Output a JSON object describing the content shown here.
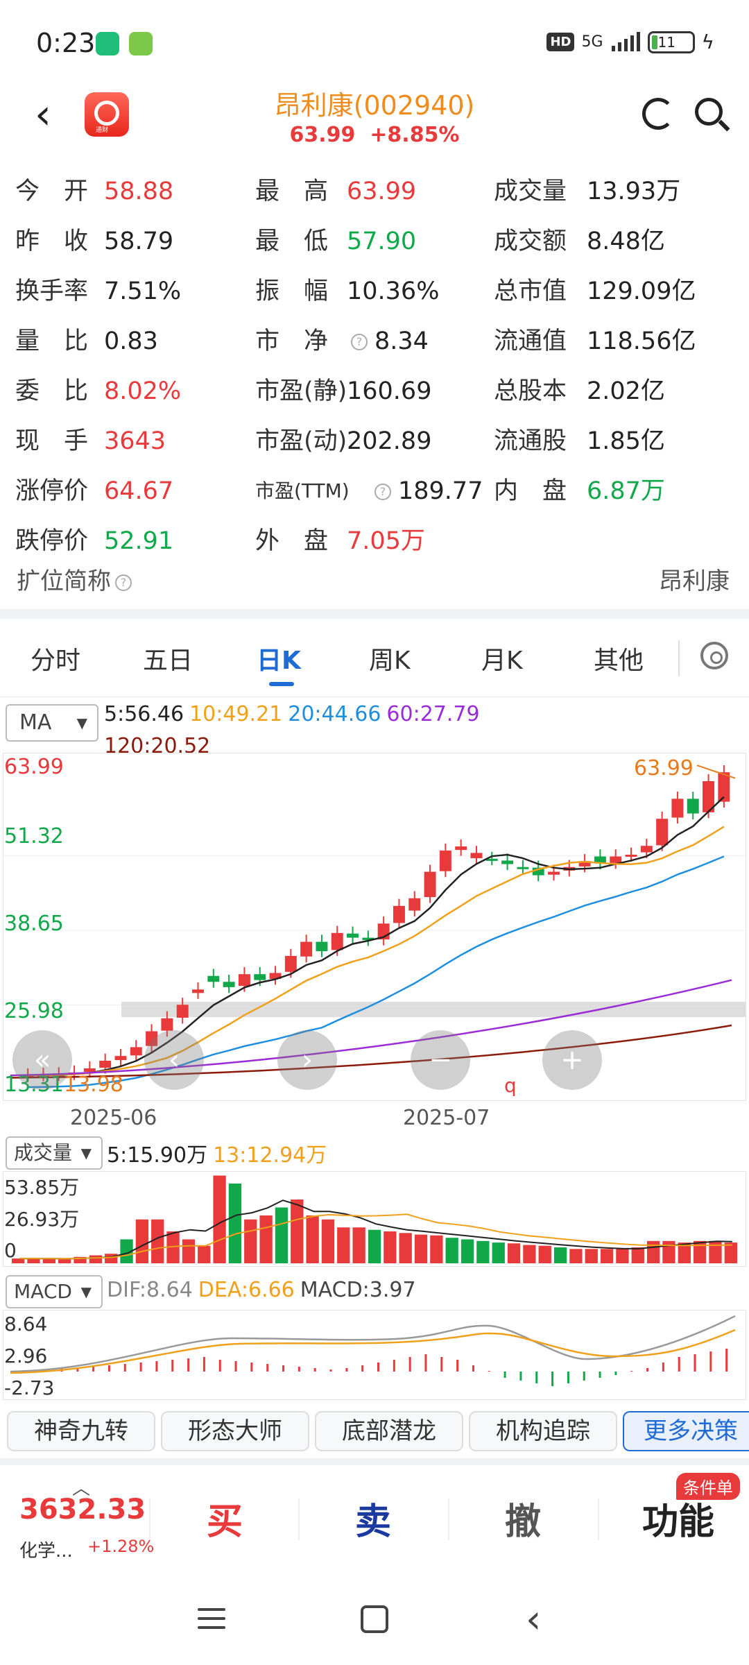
{
  "status": {
    "time": "0:23",
    "network": "5G",
    "battery": "11"
  },
  "header": {
    "title": "昂利康(002940)",
    "price": "63.99",
    "change_pct": "+8.85%",
    "logo_tag": "通财"
  },
  "quote": [
    [
      {
        "label": "今　开",
        "value": "58.88",
        "cls": "red"
      },
      {
        "label": "最　高",
        "value": "63.99",
        "cls": "red"
      },
      {
        "label": "成交量",
        "value": "13.93万",
        "cls": ""
      }
    ],
    [
      {
        "label": "昨　收",
        "value": "58.79",
        "cls": ""
      },
      {
        "label": "最　低",
        "value": "57.90",
        "cls": "green"
      },
      {
        "label": "成交额",
        "value": "8.48亿",
        "cls": ""
      }
    ],
    [
      {
        "label": "换手率",
        "value": "7.51%",
        "cls": ""
      },
      {
        "label": "振　幅",
        "value": "10.36%",
        "cls": ""
      },
      {
        "label": "总市值",
        "value": "129.09亿",
        "cls": ""
      }
    ],
    [
      {
        "label": "量　比",
        "value": "0.83",
        "cls": ""
      },
      {
        "label": "市　净",
        "value": "8.34",
        "cls": "",
        "hint": true
      },
      {
        "label": "流通值",
        "value": "118.56亿",
        "cls": ""
      }
    ],
    [
      {
        "label": "委　比",
        "value": "8.02%",
        "cls": "red"
      },
      {
        "label": "市盈(静)",
        "value": "160.69",
        "cls": ""
      },
      {
        "label": "总股本",
        "value": "2.02亿",
        "cls": ""
      }
    ],
    [
      {
        "label": "现　手",
        "value": "3643",
        "cls": "red"
      },
      {
        "label": "市盈(动)",
        "value": "202.89",
        "cls": ""
      },
      {
        "label": "流通股",
        "value": "1.85亿",
        "cls": ""
      }
    ],
    [
      {
        "label": "涨停价",
        "value": "64.67",
        "cls": "red"
      },
      {
        "label": "市盈(TTM)",
        "value": "189.77",
        "cls": "",
        "hint": true
      },
      {
        "label": "内　盘",
        "value": "6.87万",
        "cls": "green"
      }
    ],
    [
      {
        "label": "跌停价",
        "value": "52.91",
        "cls": "green"
      },
      {
        "label": "外　盘",
        "value": "7.05万",
        "cls": "red"
      }
    ]
  ],
  "expand": {
    "label": "扩位简称",
    "value": "昂利康"
  },
  "tabs": [
    "分时",
    "五日",
    "日K",
    "周K",
    "月K",
    "其他"
  ],
  "ma": {
    "selector": "MA",
    "items": [
      {
        "text": "5:56.46",
        "color": "#222222"
      },
      {
        "text": "10:49.21",
        "color": "#f0a01a"
      },
      {
        "text": "20:44.66",
        "color": "#1e8fe0"
      },
      {
        "text": "60:27.79",
        "color": "#9b2bd6"
      },
      {
        "text": "120:20.52",
        "color": "#8b1a0a"
      }
    ]
  },
  "kchart": {
    "y_labels": [
      {
        "text": "63.99",
        "color": "#e83a3a"
      },
      {
        "text": "51.32",
        "color": "#11a84a"
      },
      {
        "text": "38.65",
        "color": "#11a84a"
      },
      {
        "text": "25.98",
        "color": "#11a84a"
      },
      {
        "text": "13.31",
        "color": "#11a84a"
      }
    ],
    "x_labels": [
      "2025-06",
      "2025-07"
    ],
    "high_mark": "63.99",
    "low_mark": "13.98",
    "q_mark": "q",
    "ctrl_prev": "«",
    "ctrl_left": "‹",
    "ctrl_right": "›",
    "ctrl_minus": "−",
    "ctrl_plus": "+"
  },
  "volume": {
    "selector": "成交量",
    "items": [
      {
        "text": "5:15.90万",
        "color": "#222222"
      },
      {
        "text": "13:12.94万",
        "color": "#f0a01a"
      }
    ],
    "y_labels": [
      "53.85万",
      "26.93万",
      "0"
    ]
  },
  "macd": {
    "selector": "MACD",
    "items": [
      {
        "text": "DIF:8.64",
        "color": "#888888"
      },
      {
        "text": "DEA:6.66",
        "color": "#f0a01a"
      },
      {
        "text": "MACD:3.97",
        "color": "#444444"
      }
    ],
    "y_labels": [
      "8.64",
      "2.96",
      "-2.73"
    ]
  },
  "chips": [
    "神奇九转",
    "形态大师",
    "底部潜龙",
    "机构追踪",
    "更多决策"
  ],
  "trade": {
    "index_price": "3632.33",
    "index_name": "化学...",
    "index_change": "+1.28%",
    "buy": "买",
    "sell": "卖",
    "cancel": "撤",
    "func": "功能",
    "badge": "条件单"
  },
  "colors": {
    "up": "#e83a3a",
    "down": "#11a84a",
    "accent": "#1e6bd6"
  }
}
